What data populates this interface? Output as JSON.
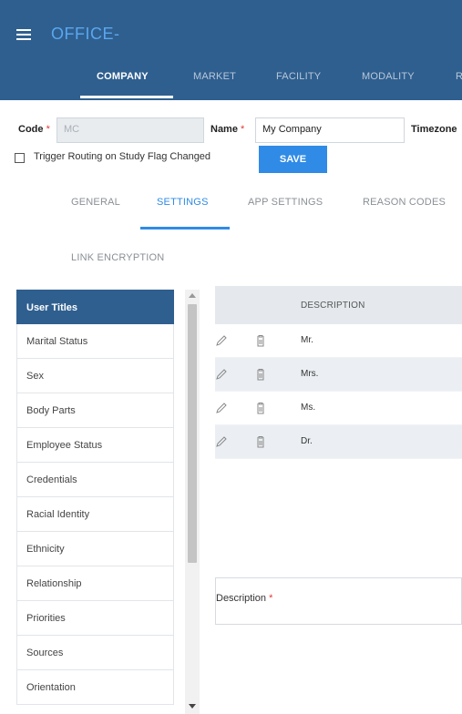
{
  "app": {
    "title": "OFFICE-"
  },
  "top_tabs": [
    {
      "label": "COMPANY",
      "active": true
    },
    {
      "label": "MARKET",
      "active": false
    },
    {
      "label": "FACILITY",
      "active": false
    },
    {
      "label": "MODALITY",
      "active": false
    },
    {
      "label": "R",
      "active": false
    }
  ],
  "form": {
    "code_label": "Code",
    "code_value": "MC",
    "name_label": "Name",
    "name_value": "My Company",
    "timezone_label": "Timezone",
    "required_marker": "*",
    "trigger_label": "Trigger Routing on Study Flag Changed",
    "trigger_checked": false,
    "save_label": "SAVE"
  },
  "sub_tabs": [
    {
      "label": "GENERAL",
      "active": false
    },
    {
      "label": "SETTINGS",
      "active": true
    },
    {
      "label": "APP SETTINGS",
      "active": false
    },
    {
      "label": "REASON CODES",
      "active": false
    },
    {
      "label": "LINK ENCRYPTION",
      "active": false
    }
  ],
  "left_list": [
    {
      "label": "User Titles",
      "active": true
    },
    {
      "label": "Marital Status",
      "active": false
    },
    {
      "label": "Sex",
      "active": false
    },
    {
      "label": "Body Parts",
      "active": false
    },
    {
      "label": "Employee Status",
      "active": false
    },
    {
      "label": "Credentials",
      "active": false
    },
    {
      "label": "Racial Identity",
      "active": false
    },
    {
      "label": "Ethnicity",
      "active": false
    },
    {
      "label": "Relationship",
      "active": false
    },
    {
      "label": "Priorities",
      "active": false
    },
    {
      "label": "Sources",
      "active": false
    },
    {
      "label": "Orientation",
      "active": false
    }
  ],
  "table": {
    "header": "DESCRIPTION",
    "rows": [
      {
        "description": "Mr."
      },
      {
        "description": "Mrs."
      },
      {
        "description": "Ms."
      },
      {
        "description": "Dr."
      }
    ]
  },
  "description_field": {
    "label": "Description",
    "required_marker": "*"
  },
  "colors": {
    "header_bg": "#2f5f8f",
    "accent": "#2f8be6",
    "required": "#e53935"
  }
}
